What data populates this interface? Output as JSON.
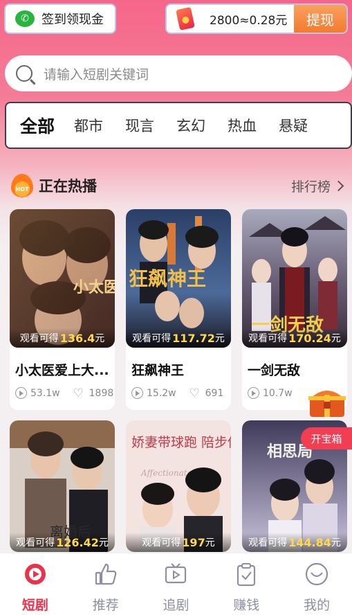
{
  "top": {
    "signin_label": "签到领现金",
    "coins_text": "2800≈0.28元",
    "withdraw_label": "提现"
  },
  "search": {
    "placeholder": "请输入短剧关键词"
  },
  "tabs": [
    {
      "label": "全部",
      "active": true
    },
    {
      "label": "都市"
    },
    {
      "label": "现言"
    },
    {
      "label": "玄幻"
    },
    {
      "label": "热血"
    },
    {
      "label": "悬疑"
    }
  ],
  "section": {
    "hot_badge": "HOT",
    "title": "正在热播",
    "ranking_label": "排行榜"
  },
  "cards": [
    {
      "poster_text": "小太医 入白",
      "earn_prefix": "观看可得",
      "earn_amount": "136.4",
      "earn_suffix": "元",
      "title": "小太医爱上大...",
      "plays": "53.1w",
      "likes": "1898",
      "colors": [
        "#3a2a2a",
        "#7a5a40",
        "#c98a4a"
      ]
    },
    {
      "poster_text": "狂飙神王",
      "earn_prefix": "观看可得",
      "earn_amount": "117.72",
      "earn_suffix": "元",
      "title": "狂飙神王",
      "plays": "15.2w",
      "likes": "691",
      "colors": [
        "#1f2e4a",
        "#3d5a86",
        "#c47a3a"
      ]
    },
    {
      "poster_text": "一剑无敌",
      "earn_prefix": "观看可得",
      "earn_amount": "170.24",
      "earn_suffix": "元",
      "title": "一剑无敌",
      "plays": "10.7w",
      "likes": "",
      "colors": [
        "#8d8ea8",
        "#4a3c56",
        "#c9a3a0"
      ]
    },
    {
      "poster_text": "离婚后",
      "earn_prefix": "观看可得",
      "earn_amount": "126.42",
      "earn_suffix": "元",
      "colors": [
        "#d9cfc6",
        "#7a5a48",
        "#2a2a2a"
      ]
    },
    {
      "poster_text": "娇妻带球跑 陪步你走开",
      "poster_sub": "Affectionate",
      "earn_prefix": "观看可得",
      "earn_amount": "197",
      "earn_suffix": "元",
      "colors": [
        "#f3e1df",
        "#e8c9c6",
        "#5b4c4a"
      ]
    },
    {
      "poster_text": "相思局",
      "earn_prefix": "观看可得",
      "earn_amount": "144.84",
      "earn_suffix": "元",
      "colors": [
        "#3f3a5a",
        "#8a86a8",
        "#d9d4e6"
      ]
    }
  ],
  "treasure_label": "开宝箱",
  "nav": [
    {
      "label": "短剧",
      "icon": "play-circle-icon",
      "active": true
    },
    {
      "label": "推荐",
      "icon": "thumbs-up-icon"
    },
    {
      "label": "追剧",
      "icon": "tv-icon"
    },
    {
      "label": "赚钱",
      "icon": "clipboard-check-icon"
    },
    {
      "label": "我的",
      "icon": "smile-icon"
    }
  ],
  "colors": {
    "accent": "#e8334a",
    "withdraw": "#f37b2d",
    "earn_amount": "#ffd84d"
  }
}
